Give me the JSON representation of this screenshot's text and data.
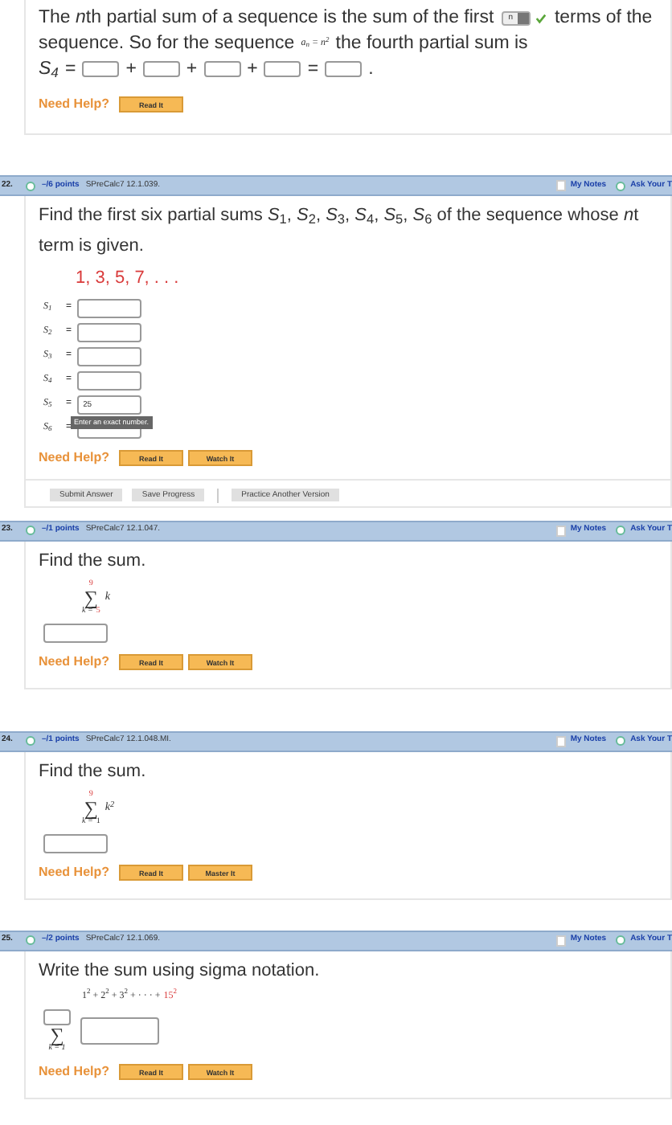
{
  "intro": {
    "lead": "The",
    "variable": "n",
    "text_before": "th partial sum of a sequence is the sum of the first",
    "dropdown": {
      "value": "n",
      "correct": true
    },
    "text_after": "terms of the",
    "line2_before": "sequence. So for the sequence",
    "formula": "a$_{n}$ = n$^{2}$",
    "line2_after": "the fourth partial sum is",
    "equation": {
      "label": "S$_{4}$",
      "operators": [
        "=",
        "+",
        "+",
        "+",
        "="
      ],
      "end": "."
    },
    "help": {
      "label": "Need Help?",
      "buttons": [
        "Read It"
      ]
    }
  },
  "questions": [
    {
      "number": "22.",
      "points": "–/6 points",
      "source": "SPreCalc7 12.1.039.",
      "notes": "My Notes",
      "ask": "Ask Your T",
      "kind": "partial_sums",
      "prompt_lines": [
        "Find the first six partial sums *S*$_{1}$, *S*$_{2}$, *S*$_{3}$, *S*$_{4}$, *S*$_{5}$, *S*$_{6}$ of the sequence whose",
        "term is given."
      ],
      "prompt_variable": "n",
      "prompt_cut": "t",
      "sequence": "1, 3, 5, 7, . . .",
      "rows": [
        {
          "label": "S$_{1}$",
          "sign": "="
        },
        {
          "label": "S$_{2}$",
          "sign": "="
        },
        {
          "label": "S$_{3}$",
          "sign": "="
        },
        {
          "label": "S$_{4}$",
          "sign": "="
        },
        {
          "label": "S$_{5}$",
          "sign": "=",
          "value": "25",
          "tooltip": "Enter an exact number."
        },
        {
          "label": "S$_{6}$",
          "sign": "="
        }
      ],
      "help": {
        "label": "Need Help?",
        "buttons": [
          "Read It",
          "Watch It"
        ]
      },
      "actions": [
        "Submit Answer",
        "Save Progress",
        "Practice Another Version"
      ]
    },
    {
      "number": "23.",
      "points": "–/1 points",
      "source": "SPreCalc7 12.1.047.",
      "notes": "My Notes",
      "ask": "Ask Your T",
      "kind": "sum",
      "prompt_lines": [
        "Find the sum."
      ],
      "sigma": "∑",
      "upper": {
        "text": "9",
        "highlighted": true
      },
      "lower_var": "k =",
      "lower_value": {
        "text": "5",
        "highlighted": true
      },
      "term": "k",
      "help": {
        "label": "Need Help?",
        "buttons": [
          "Read It",
          "Watch It"
        ]
      }
    },
    {
      "number": "24.",
      "points": "–/1 points",
      "source": "SPreCalc7 12.1.048.MI.",
      "notes": "My Notes",
      "ask": "Ask Your T",
      "kind": "sum",
      "prompt_lines": [
        "Find the sum."
      ],
      "sigma": "∑",
      "upper": {
        "text": "9",
        "highlighted": true
      },
      "lower_var": "k =",
      "lower_value": {
        "text": "1",
        "highlighted": false
      },
      "term": "k$^{2}$",
      "help": {
        "label": "Need Help?",
        "buttons": [
          "Read It",
          "Master It"
        ]
      }
    },
    {
      "number": "25.",
      "points": "–/2 points",
      "source": "SPreCalc7 12.1.069.",
      "notes": "My Notes",
      "ask": "Ask Your T",
      "kind": "sigma_notation",
      "prompt_lines": [
        "Write the sum using sigma notation."
      ],
      "series": "1$^{2}$ + 2$^{2}$ + 3$^{2}$ + · · · +",
      "series_last": "15$^{2}$",
      "sigma": "∑",
      "lower": "k = 1",
      "help": {
        "label": "Need Help?",
        "buttons": [
          "Read It",
          "Watch It"
        ]
      }
    }
  ]
}
